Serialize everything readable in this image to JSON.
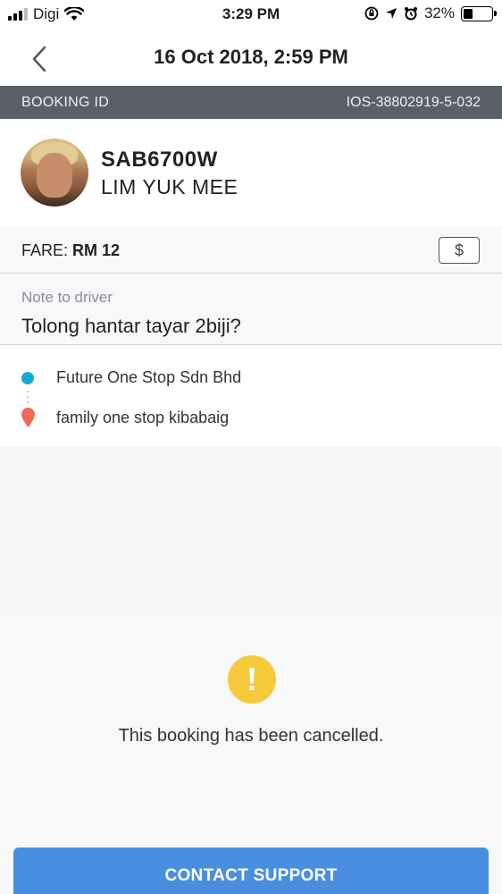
{
  "status_bar": {
    "carrier": "Digi",
    "time": "3:29 PM",
    "battery_percent": "32%",
    "battery_level": 0.32,
    "icons": [
      "signal-icon",
      "wifi-icon",
      "orientation-lock-icon",
      "location-arrow-icon",
      "alarm-icon",
      "battery-icon"
    ]
  },
  "header": {
    "title": "16 Oct 2018, 2:59 PM",
    "back_icon": "chevron-left-icon"
  },
  "booking": {
    "label": "BOOKING ID",
    "id": "IOS-38802919-5-032"
  },
  "driver": {
    "plate": "SAB6700W",
    "name": "LIM YUK MEE"
  },
  "fare": {
    "label": "FARE:",
    "value": "RM 12",
    "payment_symbol": "$"
  },
  "note": {
    "label": "Note to driver",
    "value": "Tolong hantar tayar 2biji?"
  },
  "route": {
    "pickup": "Future One Stop Sdn Bhd",
    "dropoff": "family one stop kibabaig"
  },
  "cancellation": {
    "icon_symbol": "!",
    "message": "This booking has been cancelled."
  },
  "actions": {
    "contact_support": "CONTACT SUPPORT"
  },
  "colors": {
    "booking_bar": "#5a5f68",
    "pickup_dot": "#17a8d4",
    "dropoff_pin": "#ef6a55",
    "warning": "#f5c93a",
    "primary_button": "#4a8ee0"
  }
}
